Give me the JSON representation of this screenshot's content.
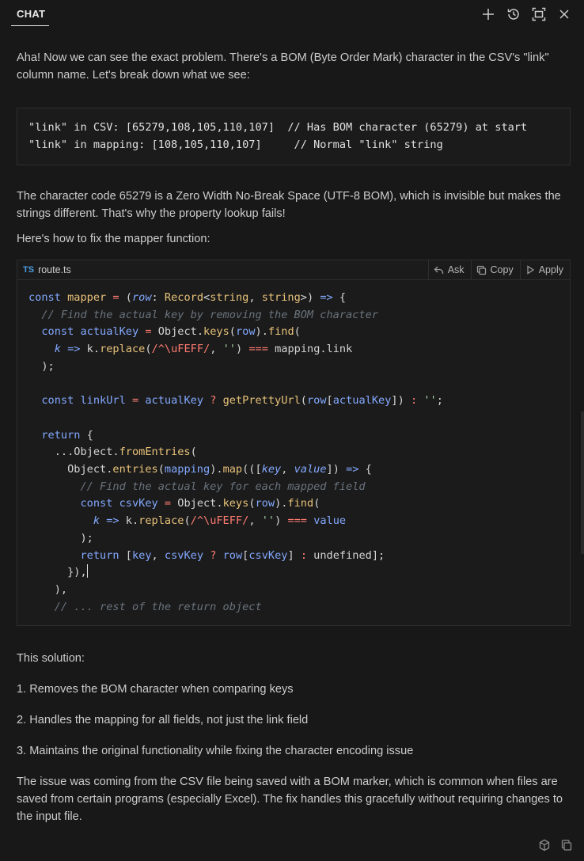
{
  "header": {
    "tab_label": "CHAT",
    "icons": [
      "plus-icon",
      "history-icon",
      "maximize-icon",
      "close-icon"
    ]
  },
  "message": {
    "intro": "Aha! Now we can see the exact problem. There's a BOM (Byte Order Mark) character in the CSV's \"link\" column name. Let's break down what we see:",
    "pre_lines": [
      "\"link\" in CSV: [65279,108,105,110,107]  // Has BOM character (65279) at start",
      "\"link\" in mapping: [108,105,110,107]     // Normal \"link\" string"
    ],
    "explanation": "The character code 65279 is a Zero Width No-Break Space (UTF-8 BOM), which is invisible but makes the strings different. That's why the property lookup fails!",
    "fix_intro": "Here's how to fix the mapper function:",
    "code_block": {
      "lang": "TS",
      "file_name": "route.ts",
      "actions": {
        "ask": "Ask",
        "copy": "Copy",
        "apply": "Apply"
      }
    },
    "solution_heading": "This solution:",
    "solution_items": [
      "1. Removes the BOM character when comparing keys",
      "2. Handles the mapping for all fields, not just the link field",
      "3. Maintains the original functionality while fixing the character encoding issue"
    ],
    "closing": "The issue was coming from the CSV file being saved with a BOM marker, which is common when files are saved from certain programs (especially Excel). The fix handles this gracefully without requiring changes to the input file."
  },
  "footer": {
    "icons": [
      "cube-icon",
      "copy-icon"
    ]
  }
}
